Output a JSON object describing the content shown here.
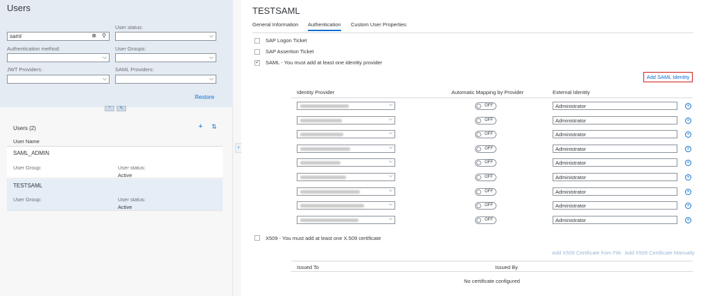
{
  "left": {
    "title": "Users",
    "search": {
      "value": "saml"
    },
    "filters": {
      "user_status": "User status:",
      "auth_method": "Authentication method:",
      "user_groups": "User Groups:",
      "jwt_providers": "JWT Providers:",
      "saml_providers": "SAML Providers:"
    },
    "restore": "Restore",
    "list": {
      "count_label": "Users (2)",
      "column": "User Name",
      "rows": [
        {
          "name": "SAML_ADMIN",
          "group_label": "User Group:",
          "status_label": "User status:",
          "status": "Active"
        },
        {
          "name": "TESTSAML",
          "group_label": "User Group:",
          "status_label": "User status:",
          "status": "Active"
        }
      ]
    }
  },
  "right": {
    "title": "TESTSAML",
    "tabs": [
      "General Information",
      "Authentication",
      "Custom User Properties"
    ],
    "active_tab": "Authentication",
    "options": {
      "logon_ticket": "SAP Logon Ticket",
      "assertion_ticket": "SAP Assertion Ticket",
      "saml": "SAML - You must add at least one identity provider",
      "x509": "X509 - You must add at least one X.509 certificate"
    },
    "add_saml": "Add SAML Identity",
    "saml_table": {
      "col_idp": "Identity Provider",
      "col_mapping": "Automatic Mapping by Provider",
      "col_external": "External Identity",
      "toggle_label": "OFF",
      "rows": [
        {
          "external": "Administrator"
        },
        {
          "external": "Administrator"
        },
        {
          "external": "Administrator"
        },
        {
          "external": "Administrator"
        },
        {
          "external": "Administrator"
        },
        {
          "external": "Administrator"
        },
        {
          "external": "Administrator"
        },
        {
          "external": "Administrator"
        },
        {
          "external": "Administrator"
        }
      ]
    },
    "x509_links": {
      "from_file": "Add X509 Certificate from File",
      "manually": "Add X509 Certificate Manually"
    },
    "cert_table": {
      "col_issued_to": "Issued To",
      "col_issued_by": "Issued By",
      "empty": "No certificate configured"
    }
  },
  "colors": {
    "accent": "#0a6ed1",
    "highlight_border": "#cc1919",
    "filter_bg": "#e4ebf3",
    "selected_row": "#e5edf6"
  },
  "icons": [
    "clear-icon",
    "search-icon",
    "chevron-down-icon",
    "add-icon",
    "sort-icon",
    "remove-icon",
    "pin-icon",
    "chevron-up-icon",
    "chevron-right-icon",
    "check-icon"
  ]
}
